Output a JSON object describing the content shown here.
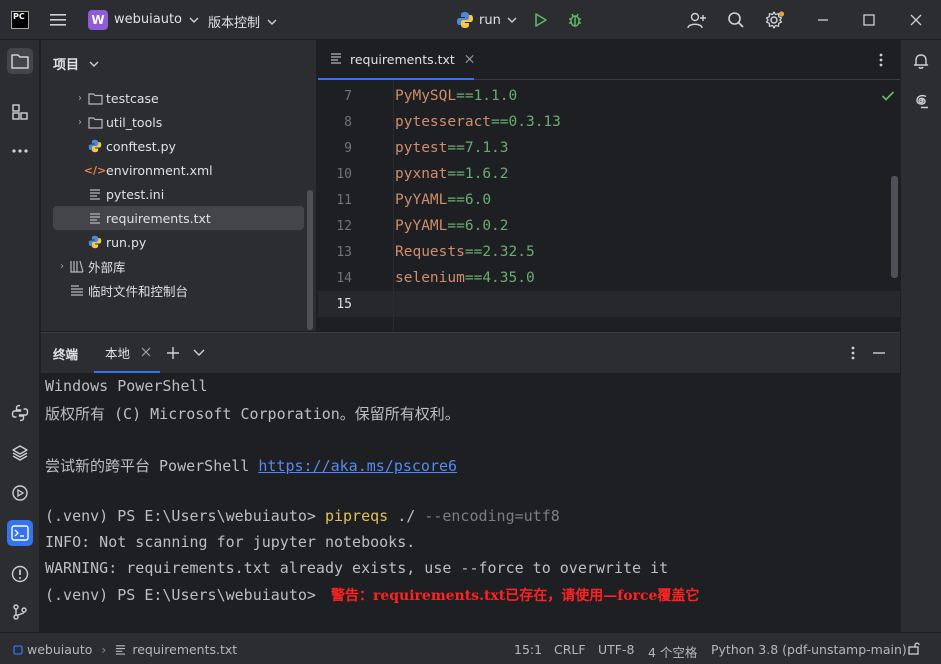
{
  "titlebar": {
    "logo": "PC",
    "project_badge": "W",
    "project_name": "webuiauto",
    "vcs_label": "版本控制",
    "run_config": "run"
  },
  "project_panel": {
    "title": "项目",
    "items": [
      {
        "label": "testcase",
        "type": "folder"
      },
      {
        "label": "util_tools",
        "type": "folder"
      },
      {
        "label": "conftest.py",
        "type": "python"
      },
      {
        "label": "environment.xml",
        "type": "xml"
      },
      {
        "label": "pytest.ini",
        "type": "text"
      },
      {
        "label": "requirements.txt",
        "type": "text"
      },
      {
        "label": "run.py",
        "type": "python"
      },
      {
        "label": "外部库",
        "type": "library"
      },
      {
        "label": "临时文件和控制台",
        "type": "scratch"
      }
    ]
  },
  "editor": {
    "tab_label": "requirements.txt",
    "lines": [
      {
        "num": "7",
        "pkg": "PyMySQL",
        "op": "==",
        "ver": "1.1.0"
      },
      {
        "num": "8",
        "pkg": "pytesseract",
        "op": "==",
        "ver": "0.3.13"
      },
      {
        "num": "9",
        "pkg": "pytest",
        "op": "==",
        "ver": "7.1.3"
      },
      {
        "num": "10",
        "pkg": "pyxnat",
        "op": "==",
        "ver": "1.6.2"
      },
      {
        "num": "11",
        "pkg": "PyYAML",
        "op": "==",
        "ver": "6.0"
      },
      {
        "num": "12",
        "pkg": "PyYAML",
        "op": "==",
        "ver": "6.0.2"
      },
      {
        "num": "13",
        "pkg": "Requests",
        "op": "==",
        "ver": "2.32.5"
      },
      {
        "num": "14",
        "pkg": "selenium",
        "op": "==",
        "ver": "4.35.0"
      },
      {
        "num": "15",
        "pkg": "",
        "op": "",
        "ver": ""
      }
    ]
  },
  "terminal": {
    "title": "终端",
    "tab_label": "本地",
    "lines": {
      "l1": "Windows PowerShell",
      "l2": "版权所有 (C) Microsoft Corporation。保留所有权利。",
      "l3_prefix": "尝试新的跨平台 PowerShell ",
      "l3_link": "https://aka.ms/pscore6",
      "prompt": "(.venv) PS E:\\Users\\webuiauto> ",
      "cmd": "pipreqs",
      "cmd_arg": " ./ ",
      "cmd_flag": "--encoding=utf8",
      "info": "INFO: Not scanning for jupyter notebooks.",
      "warning": "WARNING: requirements.txt already exists, use --force to overwrite it",
      "prompt2": "(.venv) PS E:\\Users\\webuiauto> ",
      "annotation": "警告：requirements.txt已存在，请使用—force覆盖它"
    }
  },
  "statusbar": {
    "project": "webuiauto",
    "file": "requirements.txt",
    "position": "15:1",
    "line_ending": "CRLF",
    "encoding": "UTF-8",
    "indent": "4 个空格",
    "interpreter": "Python 3.8 (pdf-unstamp-main)"
  },
  "colors": {
    "accent": "#3574f0",
    "project_badge": "#8e5bd9",
    "package": "#cf8e6d",
    "version": "#6aab73",
    "annotation": "#ff2222"
  }
}
